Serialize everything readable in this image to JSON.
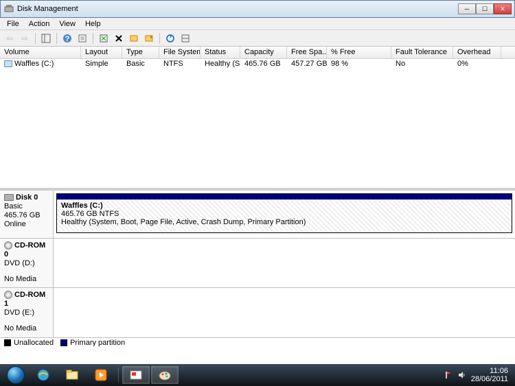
{
  "window": {
    "title": "Disk Management"
  },
  "menu": {
    "file": "File",
    "action": "Action",
    "view": "View",
    "help": "Help"
  },
  "columns": {
    "volume": "Volume",
    "layout": "Layout",
    "type": "Type",
    "filesystem": "File System",
    "status": "Status",
    "capacity": "Capacity",
    "freespace": "Free Spa...",
    "pctfree": "% Free",
    "fault": "Fault Tolerance",
    "overhead": "Overhead"
  },
  "volumes": [
    {
      "name": "Waffles (C:)",
      "layout": "Simple",
      "type": "Basic",
      "fs": "NTFS",
      "status": "Healthy (S...",
      "capacity": "465.76 GB",
      "free": "457.27 GB",
      "pctfree": "98 %",
      "fault": "No",
      "overhead": "0%"
    }
  ],
  "disks": {
    "disk0": {
      "title": "Disk 0",
      "type": "Basic",
      "size": "465.76 GB",
      "state": "Online",
      "partition": {
        "name": "Waffles  (C:)",
        "sizefs": "465.76 GB NTFS",
        "status": "Healthy (System, Boot, Page File, Active, Crash Dump, Primary Partition)"
      }
    },
    "cdrom0": {
      "title": "CD-ROM 0",
      "drive": "DVD (D:)",
      "state": "No Media"
    },
    "cdrom1": {
      "title": "CD-ROM 1",
      "drive": "DVD (E:)",
      "state": "No Media"
    }
  },
  "legend": {
    "unallocated": "Unallocated",
    "primary": "Primary partition"
  },
  "tray": {
    "time": "11:06",
    "date": "28/06/2011"
  }
}
